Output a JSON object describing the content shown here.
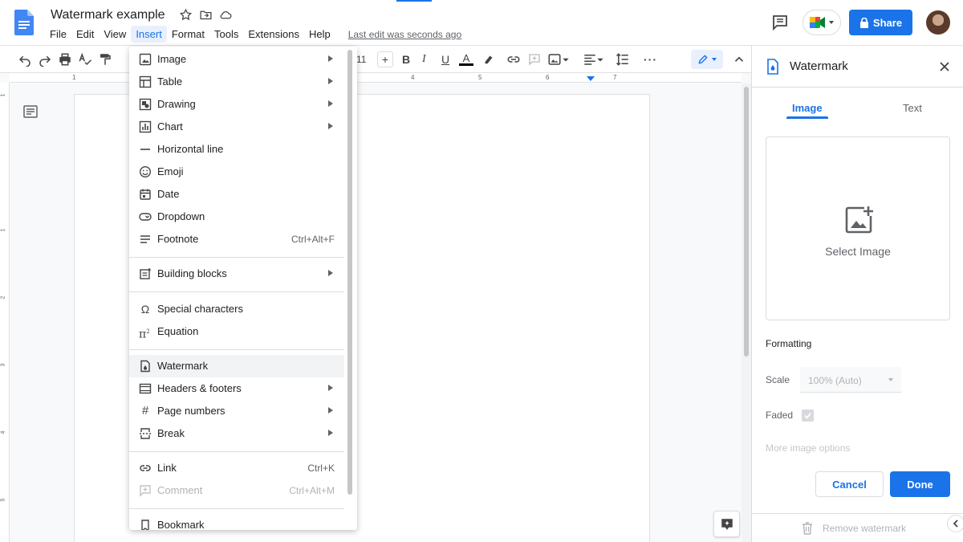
{
  "header": {
    "doc_title": "Watermark example",
    "menu": [
      "File",
      "Edit",
      "View",
      "Insert",
      "Format",
      "Tools",
      "Extensions",
      "Help"
    ],
    "last_edit": "Last edit was seconds ago",
    "share_label": "Share"
  },
  "toolbar": {
    "font_size": "11",
    "plus": "+"
  },
  "ruler": {
    "h_marks": [
      "1",
      "4",
      "5",
      "6",
      "7"
    ],
    "v_marks": [
      "1",
      "1",
      "2",
      "3",
      "4",
      "5"
    ]
  },
  "insert_menu": {
    "items": [
      {
        "label": "Image",
        "icon": "image-icon",
        "submenu": true
      },
      {
        "label": "Table",
        "icon": "table-icon",
        "submenu": true
      },
      {
        "label": "Drawing",
        "icon": "drawing-icon",
        "submenu": true
      },
      {
        "label": "Chart",
        "icon": "chart-icon",
        "submenu": true
      },
      {
        "label": "Horizontal line",
        "icon": "horizontal-line-icon"
      },
      {
        "label": "Emoji",
        "icon": "emoji-icon"
      },
      {
        "label": "Date",
        "icon": "date-icon"
      },
      {
        "label": "Dropdown",
        "icon": "dropdown-icon"
      },
      {
        "label": "Footnote",
        "icon": "footnote-icon",
        "shortcut": "Ctrl+Alt+F"
      },
      {
        "label": "Building blocks",
        "icon": "building-blocks-icon",
        "submenu": true
      },
      {
        "label": "Special characters",
        "icon": "omega-icon"
      },
      {
        "label": "Equation",
        "icon": "pi-icon"
      },
      {
        "label": "Watermark",
        "icon": "watermark-icon",
        "highlighted": true
      },
      {
        "label": "Headers & footers",
        "icon": "header-footer-icon",
        "submenu": true
      },
      {
        "label": "Page numbers",
        "icon": "hash-icon",
        "submenu": true
      },
      {
        "label": "Break",
        "icon": "break-icon",
        "submenu": true
      },
      {
        "label": "Link",
        "icon": "link-icon",
        "shortcut": "Ctrl+K"
      },
      {
        "label": "Comment",
        "icon": "comment-icon",
        "shortcut": "Ctrl+Alt+M",
        "disabled": true
      },
      {
        "label": "Bookmark",
        "icon": "bookmark-icon"
      }
    ]
  },
  "watermark_panel": {
    "title": "Watermark",
    "tabs": {
      "image": "Image",
      "text": "Text"
    },
    "select_image": "Select Image",
    "formatting": "Formatting",
    "scale_label": "Scale",
    "scale_value": "100% (Auto)",
    "faded_label": "Faded",
    "more_options": "More image options",
    "cancel": "Cancel",
    "done": "Done",
    "remove": "Remove watermark"
  },
  "colors": {
    "accent": "#1a73e8",
    "menu_highlight": "#f1f3f4",
    "disabled": "#b0b3b8"
  }
}
